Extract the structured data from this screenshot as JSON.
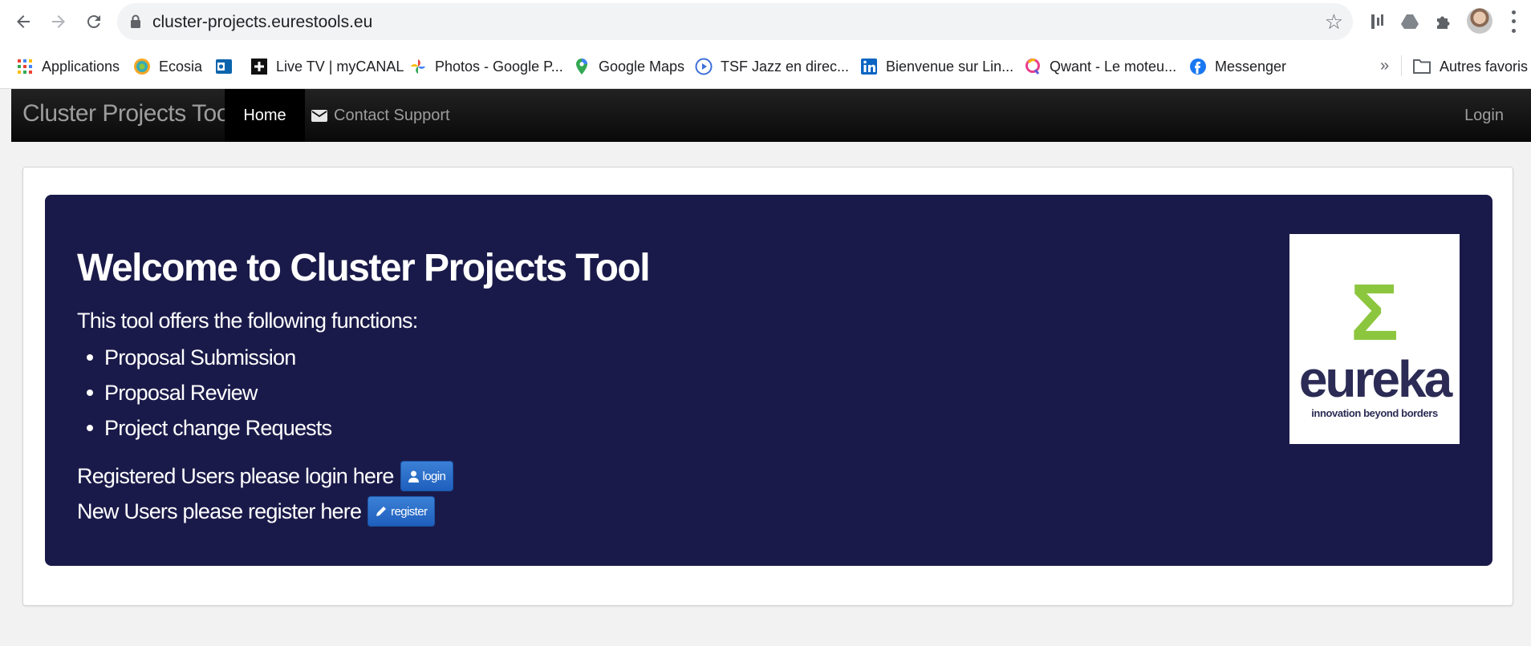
{
  "browser": {
    "url": "cluster-projects.eurestools.eu"
  },
  "bookmarks": {
    "items": [
      {
        "label": "Applications",
        "icon": "apps-grid-icon"
      },
      {
        "label": "Ecosia",
        "icon": "ecosia-icon"
      },
      {
        "label": "",
        "icon": "outlook-icon"
      },
      {
        "label": "Live TV | myCANAL",
        "icon": "mycanal-icon"
      },
      {
        "label": "Photos - Google P...",
        "icon": "google-photos-icon"
      },
      {
        "label": "Google Maps",
        "icon": "google-maps-icon"
      },
      {
        "label": "TSF Jazz en direc...",
        "icon": "tsf-jazz-icon"
      },
      {
        "label": "Bienvenue sur Lin...",
        "icon": "linkedin-icon"
      },
      {
        "label": "Qwant - Le moteu...",
        "icon": "qwant-icon"
      },
      {
        "label": "Messenger",
        "icon": "messenger-icon"
      }
    ],
    "more": "»",
    "other": "Autres favoris"
  },
  "navbar": {
    "brand": "Cluster Projects Tool",
    "home": "Home",
    "contact": "Contact Support",
    "login": "Login"
  },
  "hero": {
    "title": "Welcome to Cluster Projects Tool",
    "intro": "This tool offers the following functions:",
    "features": [
      "Proposal Submission",
      "Proposal Review",
      "Project change Requests"
    ],
    "login_text": "Registered Users please login here",
    "login_button": "login",
    "register_text": "New Users please register here",
    "register_button": "register"
  },
  "logo": {
    "symbol": "Σ",
    "word": "eureka",
    "tagline": "innovation beyond borders"
  },
  "colors": {
    "hero_bg": "#1a1a4a",
    "navbar_bg": "#0b0b0b",
    "button_blue": "#2a6fcc",
    "logo_green": "#8cc63e",
    "logo_navy": "#2b2b55"
  }
}
